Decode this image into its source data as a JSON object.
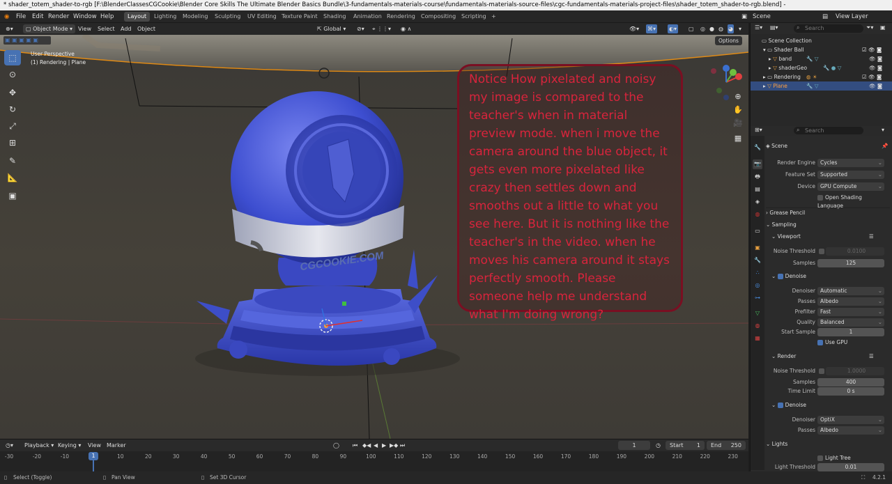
{
  "window_title": "* shader_totem_shader-to-rgb [F:\\BlenderClassesCGCookie\\Blender Core Skills The Ultimate Blender Basics Bundle\\3-fundamentals-materials-course\\fundamentals-materials-source-files\\cgc-fundamentals-materials-project-files\\shader_totem_shader-to-rgb.blend] -",
  "menus": [
    "File",
    "Edit",
    "Render",
    "Window",
    "Help"
  ],
  "workspaces": [
    "Layout",
    "Lighting",
    "Modeling",
    "Sculpting",
    "UV Editing",
    "Texture Paint",
    "Shading",
    "Animation",
    "Rendering",
    "Compositing",
    "Scripting"
  ],
  "active_workspace": "Layout",
  "scene_name": "Scene",
  "view_layer": "View Layer",
  "viewport_header": {
    "mode": "Object Mode",
    "view": "View",
    "select": "Select",
    "add": "Add",
    "object": "Object",
    "transform": "Global",
    "options": "Options"
  },
  "viewport_overlay": {
    "line1": "User Perspective",
    "line2": "(1) Rendering | Plane"
  },
  "annotation": "Notice How pixelated and noisy my image is compared to the teacher's when in material preview mode. when i move the camera around the blue object, it gets even more pixelated like crazy then settles down and smooths out a little to what you see here. But it is nothing like the teacher's in the video. when he moves his camera around it stays perfectly smooth. Please someone help me understand what I'm doing wrong?",
  "object_label": "CGCOOKIE.COM",
  "outliner": {
    "search_placeholder": "Search",
    "root": "Scene Collection",
    "rows": [
      {
        "label": "Shader Ball",
        "indent": 1
      },
      {
        "label": "band",
        "indent": 2
      },
      {
        "label": "shaderGeo",
        "indent": 2
      },
      {
        "label": "Rendering",
        "indent": 1
      },
      {
        "label": "Plane",
        "indent": 1
      }
    ]
  },
  "properties": {
    "search_placeholder": "Search",
    "context": "Scene",
    "render_engine": {
      "label": "Render Engine",
      "value": "Cycles"
    },
    "feature_set": {
      "label": "Feature Set",
      "value": "Supported"
    },
    "device": {
      "label": "Device",
      "value": "GPU Compute"
    },
    "osl": "Open Shading Language",
    "grease_pencil": "Grease Pencil",
    "sampling": "Sampling",
    "viewport": "Viewport",
    "vp_noise": {
      "label": "Noise Threshold",
      "value": "0.0100"
    },
    "vp_samples": {
      "label": "Samples",
      "value": "125"
    },
    "denoise": "Denoise",
    "vp_denoiser": {
      "label": "Denoiser",
      "value": "Automatic"
    },
    "vp_passes": {
      "label": "Passes",
      "value": "Albedo"
    },
    "vp_prefilter": {
      "label": "Prefilter",
      "value": "Fast"
    },
    "vp_quality": {
      "label": "Quality",
      "value": "Balanced"
    },
    "vp_start": {
      "label": "Start Sample",
      "value": "1"
    },
    "use_gpu": "Use GPU",
    "render": "Render",
    "r_noise": {
      "label": "Noise Threshold",
      "value": "1.0000"
    },
    "r_samples": {
      "label": "Samples",
      "value": "400"
    },
    "r_time": {
      "label": "Time Limit",
      "value": "0 s"
    },
    "r_denoiser": {
      "label": "Denoiser",
      "value": "OptiX"
    },
    "r_passes": {
      "label": "Passes",
      "value": "Albedo"
    },
    "lights": "Lights",
    "light_tree": "Light Tree",
    "light_threshold": {
      "label": "Light Threshold",
      "value": "0.01"
    }
  },
  "timeline": {
    "playback": "Playback",
    "keying": "Keying",
    "view": "View",
    "marker": "Marker",
    "current_frame": "1",
    "start_label": "Start",
    "start": "1",
    "end_label": "End",
    "end": "250",
    "ticks": [
      "-30",
      "-20",
      "-10",
      "0",
      "10",
      "20",
      "30",
      "40",
      "50",
      "60",
      "70",
      "80",
      "90",
      "100",
      "110",
      "120",
      "130",
      "140",
      "150",
      "160",
      "170",
      "180",
      "190",
      "200",
      "210",
      "220",
      "230"
    ],
    "playhead": "1"
  },
  "status": {
    "left": "Select (Toggle)",
    "mid": "Pan View",
    "right": "Set 3D Cursor",
    "version": "4.2.1"
  }
}
